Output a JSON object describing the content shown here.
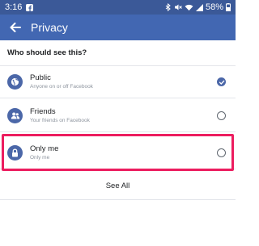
{
  "status_bar": {
    "time": "3:16",
    "battery": "58%",
    "icons": [
      "facebook-icon",
      "bluetooth-icon",
      "mute-icon",
      "wifi-icon",
      "signal-icon",
      "battery-icon"
    ]
  },
  "header": {
    "title": "Privacy",
    "back_icon": "back-arrow-icon"
  },
  "section": {
    "title": "Who should see this?"
  },
  "options": [
    {
      "label": "Public",
      "sub": "Anyone on or off Facebook",
      "icon": "globe-icon",
      "selected": true
    },
    {
      "label": "Friends",
      "sub": "Your friends on Facebook",
      "icon": "friends-icon",
      "selected": false
    },
    {
      "label": "Only me",
      "sub": "Only me",
      "icon": "lock-icon",
      "selected": false
    }
  ],
  "see_all": "See All",
  "colors": {
    "status_bar": "#3b5998",
    "app_bar": "#4267b2",
    "accent": "#4b67a8",
    "highlight": "#ec1d5f"
  }
}
